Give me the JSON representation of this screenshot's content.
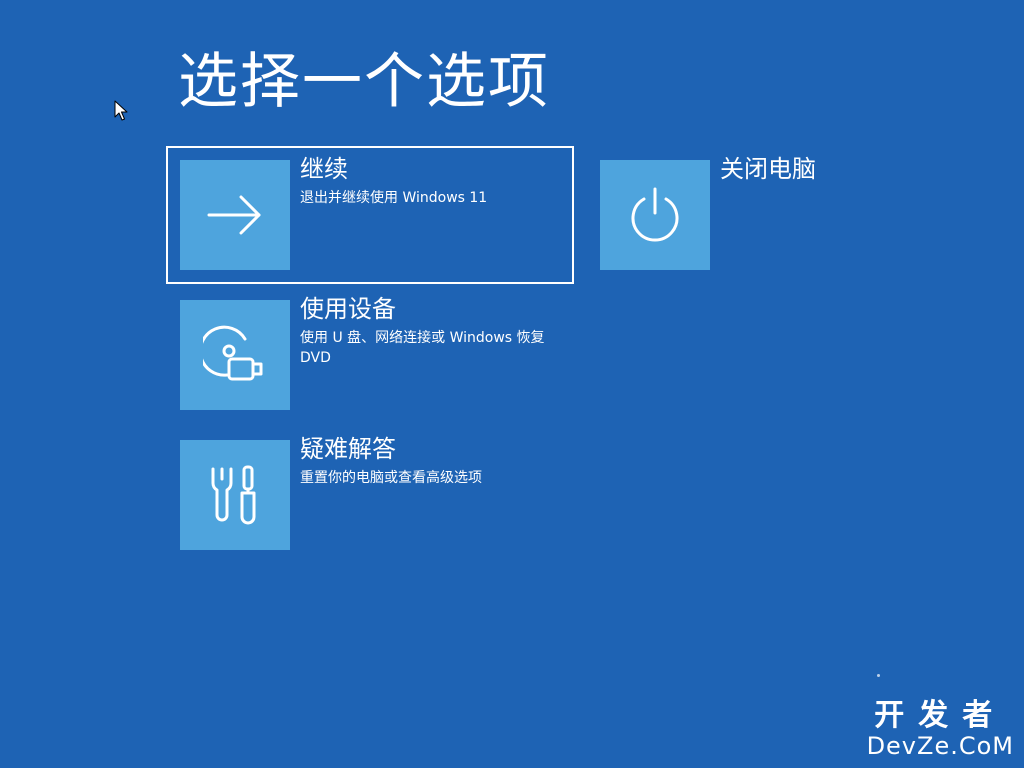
{
  "page": {
    "title": "选择一个选项",
    "background_color": "#1e63b4",
    "tile_color": "#4ea4dd"
  },
  "options": {
    "continue": {
      "title": "继续",
      "description": "退出并继续使用 Windows 11",
      "icon": "arrow-right-icon",
      "selected": true
    },
    "use_device": {
      "title": "使用设备",
      "description": "使用 U 盘、网络连接或 Windows 恢复 DVD",
      "icon": "disc-usb-icon"
    },
    "troubleshoot": {
      "title": "疑难解答",
      "description": "重置你的电脑或查看高级选项",
      "icon": "tools-icon"
    },
    "shutdown": {
      "title": "关闭电脑",
      "icon": "power-icon"
    }
  },
  "watermark": {
    "line1": "开发者",
    "line2": "DevZe.CoM"
  }
}
